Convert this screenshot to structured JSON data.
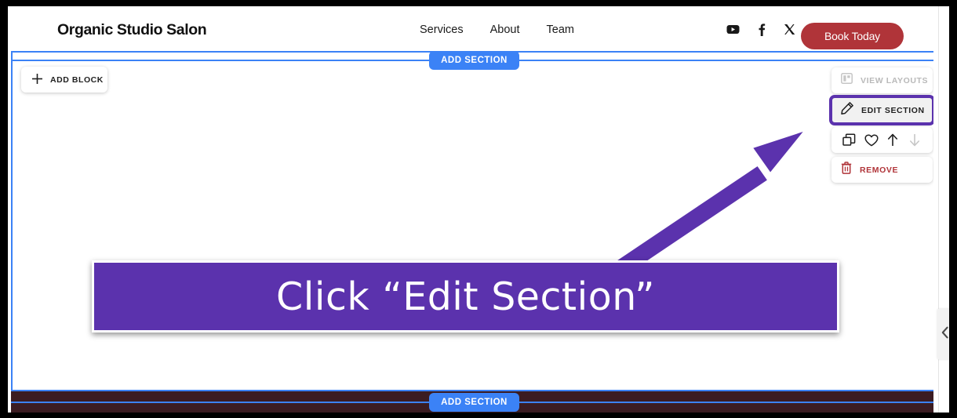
{
  "site": {
    "brand": "Organic Studio Salon",
    "nav": [
      {
        "label": "Services"
      },
      {
        "label": "About"
      },
      {
        "label": "Team"
      }
    ],
    "social": [
      {
        "name": "youtube-icon",
        "label": "YouTube"
      },
      {
        "name": "facebook-icon",
        "label": "Facebook"
      },
      {
        "name": "x-twitter-icon",
        "label": "X"
      }
    ],
    "cta": {
      "label": "Book Today",
      "color": "#b03439"
    }
  },
  "editor": {
    "add_block_label": "ADD BLOCK",
    "add_section_top_label": "ADD SECTION",
    "add_section_bottom_label": "ADD SECTION",
    "accent_blue": "#3b82f6",
    "toolbar": {
      "view_layouts_label": "VIEW LAYOUTS",
      "edit_section_label": "EDIT SECTION",
      "remove_label": "REMOVE",
      "icon_actions": [
        {
          "name": "duplicate-icon",
          "label": "Duplicate",
          "disabled": false
        },
        {
          "name": "heart-icon",
          "label": "Favorite",
          "disabled": false
        },
        {
          "name": "arrow-up-icon",
          "label": "Move Up",
          "disabled": false
        },
        {
          "name": "arrow-down-icon",
          "label": "Move Down",
          "disabled": true
        }
      ],
      "highlight_color": "#5b32ad",
      "remove_color": "#b03439"
    },
    "footer_color": "#3b1c22",
    "collapse_handle": "chevron-left-icon"
  },
  "callout": {
    "text": "Click “Edit Section”",
    "background": "#5b32ad",
    "arrow_color": "#5b32ad"
  }
}
